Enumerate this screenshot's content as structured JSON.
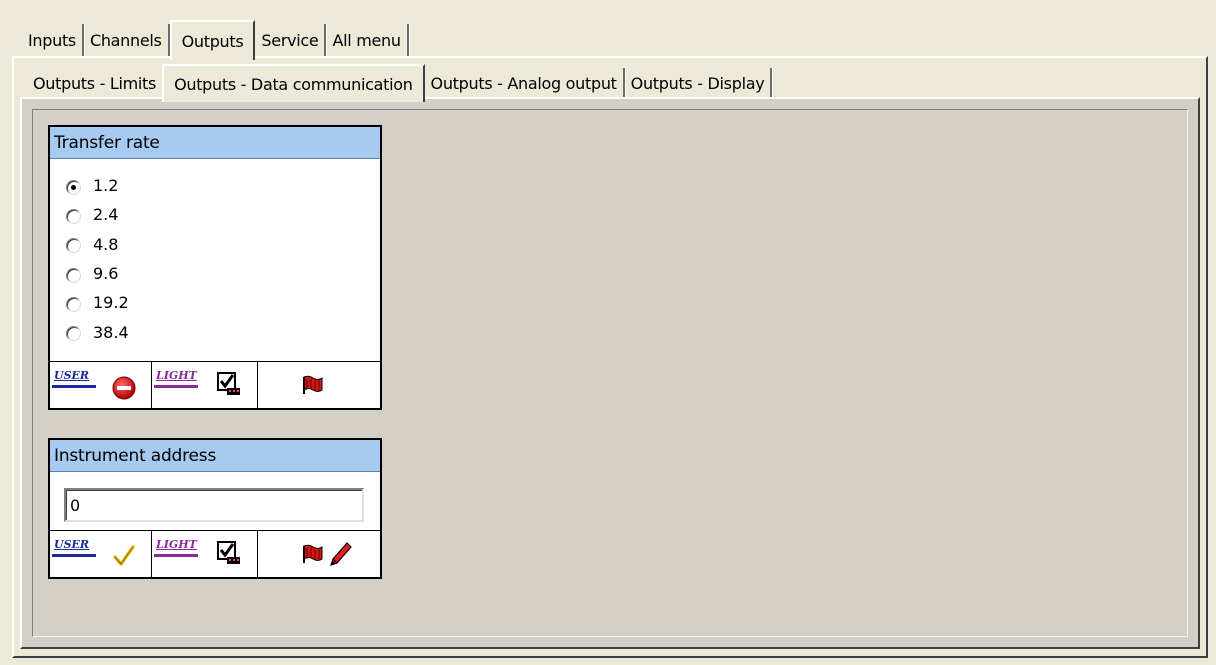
{
  "top_tabs": [
    {
      "label": "Inputs",
      "active": false
    },
    {
      "label": "Channels",
      "active": false
    },
    {
      "label": "Outputs",
      "active": true
    },
    {
      "label": "Service",
      "active": false
    },
    {
      "label": "All menu",
      "active": false
    }
  ],
  "sub_tabs": [
    {
      "label": "Outputs - Limits",
      "active": false
    },
    {
      "label": "Outputs - Data communication",
      "active": true
    },
    {
      "label": "Outputs - Analog output",
      "active": false
    },
    {
      "label": "Outputs - Display",
      "active": false
    }
  ],
  "transfer_rate": {
    "title": "Transfer rate",
    "options": [
      "1.2",
      "2.4",
      "4.8",
      "9.6",
      "19.2",
      "38.4"
    ],
    "selected": "1.2",
    "footer": {
      "user_label": "USER",
      "user_icon": "no-entry-icon",
      "light_label": "LIGHT",
      "light_icon": "checkbox-icon",
      "flag_icon": "flag-icon"
    }
  },
  "instrument_address": {
    "title": "Instrument address",
    "value": "0",
    "footer": {
      "user_label": "USER",
      "user_icon": "checkmark-icon",
      "light_label": "LIGHT",
      "light_icon": "checkbox-icon",
      "flag_icon": "flag-icon",
      "edit_icon": "pencil-icon"
    }
  },
  "colors": {
    "panel_header": "#A6CAF0",
    "window_bg": "#ECE9D8",
    "content_bg": "#D4D0C8",
    "user_tag": "#1a2a9a",
    "light_tag": "#8a2a9a",
    "flag": "#d01818"
  }
}
